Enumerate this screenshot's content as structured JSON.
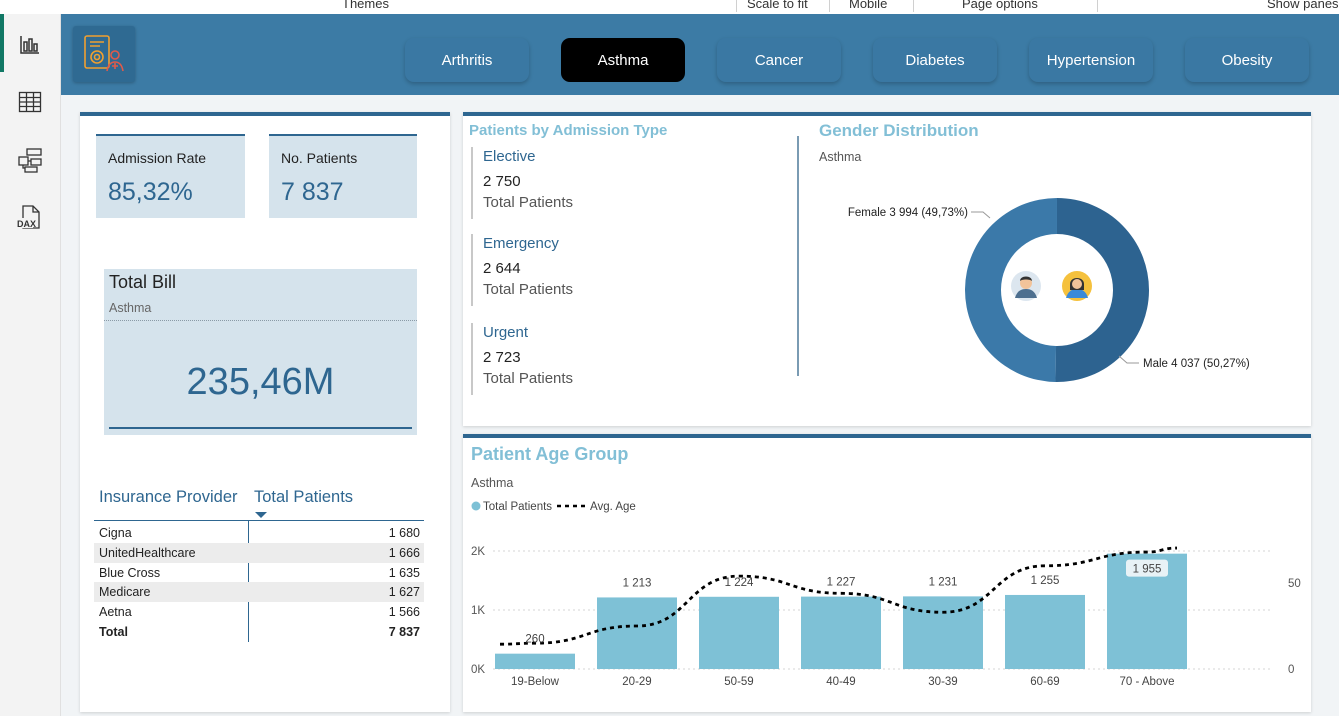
{
  "ribbon": {
    "items": [
      "Themes",
      "Scale to fit",
      "Mobile",
      "Page options",
      "Show panes"
    ]
  },
  "leftrail": {
    "icons": [
      "report-view-icon",
      "table-view-icon",
      "model-view-icon",
      "dax-query-view-icon"
    ],
    "dax_label": "DAX"
  },
  "tabs": [
    {
      "label": "Arthritis",
      "active": false
    },
    {
      "label": "Asthma",
      "active": true
    },
    {
      "label": "Cancer",
      "active": false
    },
    {
      "label": "Diabetes",
      "active": false
    },
    {
      "label": "Hypertension",
      "active": false
    },
    {
      "label": "Obesity",
      "active": false
    }
  ],
  "kpis": {
    "admission_rate": {
      "label": "Admission Rate",
      "value": "85,32%"
    },
    "patients": {
      "label": "No. Patients",
      "value": "7 837"
    }
  },
  "total_bill": {
    "title": "Total Bill",
    "subtitle": "Asthma",
    "value": "235,46M"
  },
  "insurance": {
    "header_provider": "Insurance Provider",
    "header_patients": "Total Patients",
    "rows": [
      {
        "name": "Cigna",
        "value": "1 680"
      },
      {
        "name": "UnitedHealthcare",
        "value": "1 666"
      },
      {
        "name": "Blue Cross",
        "value": "1 635"
      },
      {
        "name": "Medicare",
        "value": "1 627"
      },
      {
        "name": "Aetna",
        "value": "1 566"
      }
    ],
    "total": {
      "name": "Total",
      "value": "7 837"
    }
  },
  "admission": {
    "title": "Patients by Admission Type",
    "items": [
      {
        "type": "Elective",
        "value": "2 750",
        "caption": "Total Patients"
      },
      {
        "type": "Emergency",
        "value": "2 644",
        "caption": "Total Patients"
      },
      {
        "type": "Urgent",
        "value": "2 723",
        "caption": "Total Patients"
      }
    ]
  },
  "gender": {
    "title": "Gender Distribution",
    "subtitle": "Asthma",
    "female_label": "Female 3 994 (49,73%)",
    "male_label": "Male 4 037 (50,27%)",
    "colors": {
      "female": "#3b79a9",
      "male": "#2d6390"
    }
  },
  "age": {
    "title": "Patient Age Group",
    "subtitle": "Asthma",
    "legend_bar": "Total Patients",
    "legend_line": "Avg. Age",
    "left_ticks": [
      "2K",
      "1K",
      "0K"
    ],
    "right_ticks": [
      "50",
      "0"
    ],
    "bar_labels": [
      "260",
      "1 213",
      "1 224",
      "1 227",
      "1 231",
      "1 255",
      "1 955"
    ]
  },
  "chart_data": {
    "type": "bar",
    "title": "Patient Age Group",
    "subtitle": "Asthma",
    "categories": [
      "19-Below",
      "20-29",
      "50-59",
      "40-49",
      "30-39",
      "60-69",
      "70 - Above"
    ],
    "series": [
      {
        "name": "Total Patients",
        "type": "bar",
        "axis": "left",
        "values": [
          260,
          1213,
          1224,
          1227,
          1231,
          1255,
          1955
        ]
      },
      {
        "name": "Avg. Age",
        "type": "line",
        "axis": "right",
        "values": [
          15,
          25,
          54,
          44,
          33,
          60,
          68
        ]
      }
    ],
    "ylim_left": [
      0,
      2000
    ],
    "ylim_right": [
      0,
      75
    ],
    "legend": "top-left",
    "colors": {
      "bar": "#7ec1d6",
      "line": "#000000"
    }
  }
}
